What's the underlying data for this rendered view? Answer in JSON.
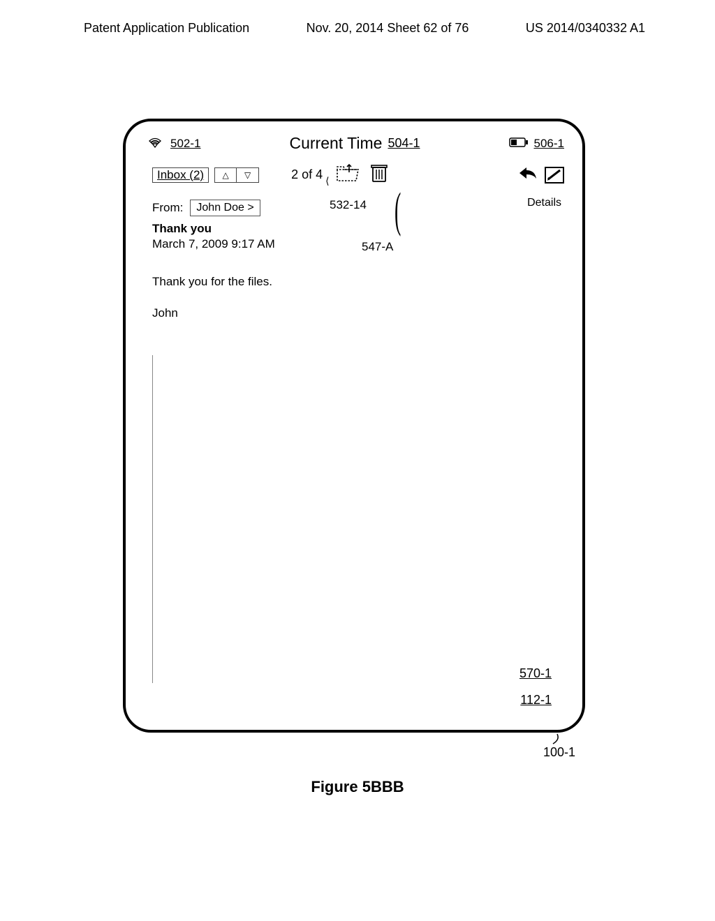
{
  "page_header": {
    "left": "Patent Application Publication",
    "center": "Nov. 20, 2014  Sheet 62 of 76",
    "right": "US 2014/0340332 A1"
  },
  "status": {
    "signal_ref": "502-1",
    "time_label": "Current Time",
    "time_ref": "504-1",
    "battery_ref": "506-1"
  },
  "nav": {
    "inbox_label": "Inbox (2)",
    "count_label": "2 of 4",
    "details_label": "Details"
  },
  "from": {
    "label": "From:",
    "sender": "John Doe  >"
  },
  "refs": {
    "folder_ref": "532-14",
    "cursor_ref": "547-A",
    "content_ref": "570-1",
    "screen_ref": "112-1",
    "device_ref": "100-1"
  },
  "message": {
    "subject": "Thank you",
    "date": "March 7, 2009   9:17 AM",
    "body_line1": "Thank you for the files.",
    "body_line2": "John"
  },
  "figure_caption": "Figure 5BBB"
}
